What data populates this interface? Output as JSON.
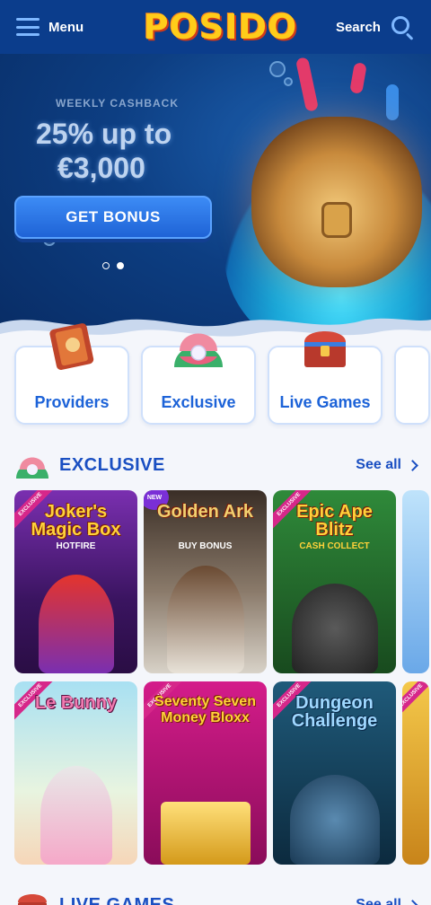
{
  "header": {
    "menu_label": "Menu",
    "logo_text": "POSIDO",
    "search_label": "Search"
  },
  "hero": {
    "eyebrow": "WEEKLY CASHBACK",
    "headline_line1": "25% up to",
    "headline_line2": "€3,000",
    "cta_label": "GET BONUS",
    "slides_total": 2,
    "active_slide": 2
  },
  "categories": [
    {
      "label": "Providers",
      "icon": "book-icon"
    },
    {
      "label": "Exclusive",
      "icon": "pearl-shell-icon"
    },
    {
      "label": "Live Games",
      "icon": "treasure-chest-icon"
    },
    {
      "label": "",
      "icon": ""
    }
  ],
  "exclusive_section": {
    "title": "EXCLUSIVE",
    "see_all": "See all"
  },
  "live_section": {
    "title": "LIVE GAMES",
    "see_all": "See all"
  },
  "games": [
    {
      "title": "Joker's Magic Box",
      "subtitle": "HOTFIRE",
      "badge": "EXCLUSIVE",
      "bg": "#5a1f8a"
    },
    {
      "title": "Golden Ark",
      "subtitle": "BUY BONUS",
      "badge": "NEW",
      "bg": "#2a2320"
    },
    {
      "title": "Epic Ape Blitz",
      "subtitle": "CASH COLLECT",
      "badge": "EXCLUSIVE",
      "bg": "#1f6b2a"
    },
    {
      "title": "",
      "subtitle": "",
      "badge": "",
      "bg": "#8fc8f5"
    },
    {
      "title": "Le Bunny",
      "subtitle": "",
      "badge": "EXCLUSIVE",
      "bg": "#8ed0ea"
    },
    {
      "title": "Seventy Seven Money Bloxx",
      "subtitle": "",
      "badge": "EXCLUSIVE",
      "bg": "#b0167a"
    },
    {
      "title": "Dungeon Challenge",
      "subtitle": "",
      "badge": "EXCLUSIVE",
      "bg": "#123a55"
    },
    {
      "title": "",
      "subtitle": "",
      "badge": "EXCLUSIVE",
      "bg": "#e8b73a"
    }
  ],
  "colors": {
    "header_bg": "#0b3d8c",
    "accent_blue": "#1a4fc2",
    "logo_yellow": "#ffcc1a",
    "exclusive_ribbon": "#d6278a"
  }
}
